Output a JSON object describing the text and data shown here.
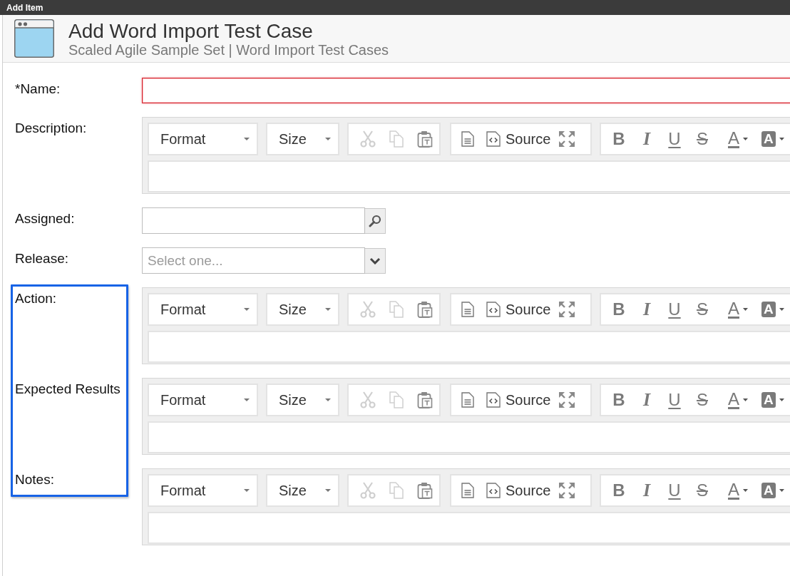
{
  "window": {
    "title": "Add Item"
  },
  "header": {
    "title": "Add Word Import Test Case",
    "breadcrumb": "Scaled Agile Sample Set | Word Import Test Cases"
  },
  "fields": [
    {
      "kind": "text",
      "label": "*Name:",
      "error": true,
      "highlighted": false
    },
    {
      "kind": "rich_text",
      "label": "Description:",
      "error": false,
      "highlighted": false,
      "toolbar": {
        "format": "Format",
        "size": "Size",
        "clipboard": [
          {
            "kind": "cut",
            "disabled": true
          },
          {
            "kind": "copy",
            "disabled": true
          },
          {
            "kind": "paste_word",
            "disabled": false
          }
        ],
        "source": "Source",
        "styles": [
          {
            "kind": "bold",
            "glyph": "B"
          },
          {
            "kind": "italic",
            "glyph": "I"
          },
          {
            "kind": "underline",
            "glyph": "U"
          },
          {
            "kind": "strike",
            "glyph": "S"
          },
          {
            "kind": "text_color",
            "glyph": "A"
          },
          {
            "kind": "background_color",
            "glyph": "A"
          }
        ]
      }
    },
    {
      "kind": "lookup",
      "label": "Assigned:",
      "error": false,
      "highlighted": false
    },
    {
      "kind": "select",
      "label": "Release:",
      "placeholder": "Select one...",
      "error": false,
      "highlighted": false
    },
    {
      "kind": "rich_text",
      "label": "Action:",
      "error": false,
      "highlighted": true,
      "toolbar": {
        "format": "Format",
        "size": "Size",
        "clipboard": [
          {
            "kind": "cut",
            "disabled": true
          },
          {
            "kind": "copy",
            "disabled": true
          },
          {
            "kind": "paste_word",
            "disabled": false
          }
        ],
        "source": "Source",
        "styles": [
          {
            "kind": "bold",
            "glyph": "B"
          },
          {
            "kind": "italic",
            "glyph": "I"
          },
          {
            "kind": "underline",
            "glyph": "U"
          },
          {
            "kind": "strike",
            "glyph": "S"
          },
          {
            "kind": "text_color",
            "glyph": "A"
          },
          {
            "kind": "background_color",
            "glyph": "A"
          }
        ]
      }
    },
    {
      "kind": "rich_text",
      "label": "Expected Results",
      "error": false,
      "highlighted": true,
      "toolbar": {
        "format": "Format",
        "size": "Size",
        "clipboard": [
          {
            "kind": "cut",
            "disabled": true
          },
          {
            "kind": "copy",
            "disabled": true
          },
          {
            "kind": "paste_word",
            "disabled": false
          }
        ],
        "source": "Source",
        "styles": [
          {
            "kind": "bold",
            "glyph": "B"
          },
          {
            "kind": "italic",
            "glyph": "I"
          },
          {
            "kind": "underline",
            "glyph": "U"
          },
          {
            "kind": "strike",
            "glyph": "S"
          },
          {
            "kind": "text_color",
            "glyph": "A"
          },
          {
            "kind": "background_color",
            "glyph": "A"
          }
        ]
      }
    },
    {
      "kind": "rich_text",
      "label": "Notes:",
      "error": false,
      "highlighted": true,
      "toolbar": {
        "format": "Format",
        "size": "Size",
        "clipboard": [
          {
            "kind": "cut",
            "disabled": true
          },
          {
            "kind": "copy",
            "disabled": true
          },
          {
            "kind": "paste_word",
            "disabled": false
          }
        ],
        "source": "Source",
        "styles": [
          {
            "kind": "bold",
            "glyph": "B"
          },
          {
            "kind": "italic",
            "glyph": "I"
          },
          {
            "kind": "underline",
            "glyph": "U"
          },
          {
            "kind": "strike",
            "glyph": "S"
          },
          {
            "kind": "text_color",
            "glyph": "A"
          },
          {
            "kind": "background_color",
            "glyph": "A"
          }
        ]
      }
    }
  ]
}
